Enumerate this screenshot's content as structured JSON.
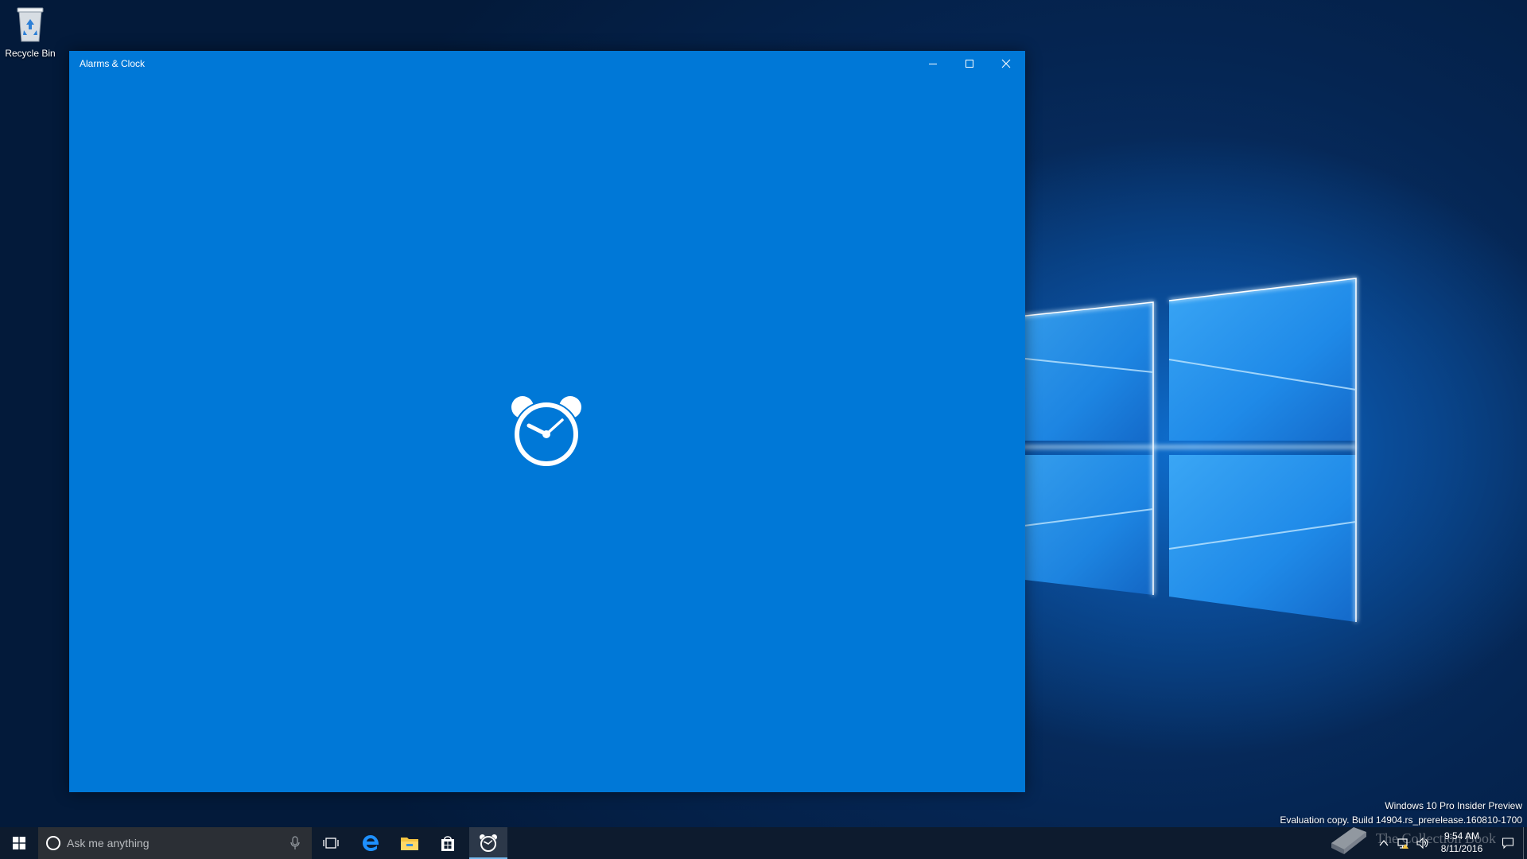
{
  "desktop": {
    "icons": [
      {
        "label": "Recycle Bin",
        "icon": "recycle-bin-icon"
      }
    ]
  },
  "window": {
    "title": "Alarms & Clock",
    "splash_icon": "alarm-clock-icon",
    "background_color": "#0078d7",
    "controls": {
      "minimize": "minimize-icon",
      "maximize": "maximize-icon",
      "close": "close-icon"
    }
  },
  "watermark": {
    "line1": "Windows 10 Pro Insider Preview",
    "line2": "Evaluation copy. Build 14904.rs_prerelease.160810-1700"
  },
  "taskbar": {
    "search_placeholder": "Ask me anything",
    "pinned": [
      {
        "name": "Task View",
        "icon": "task-view-icon"
      },
      {
        "name": "Microsoft Edge",
        "icon": "edge-icon"
      },
      {
        "name": "File Explorer",
        "icon": "folder-icon"
      },
      {
        "name": "Store",
        "icon": "store-icon"
      },
      {
        "name": "Alarms & Clock",
        "icon": "alarm-clock-icon",
        "active": true
      }
    ],
    "clock": {
      "time": "9:54 AM",
      "date": "8/11/2016"
    }
  },
  "overlay": {
    "brand_text": "The Collection Book"
  }
}
